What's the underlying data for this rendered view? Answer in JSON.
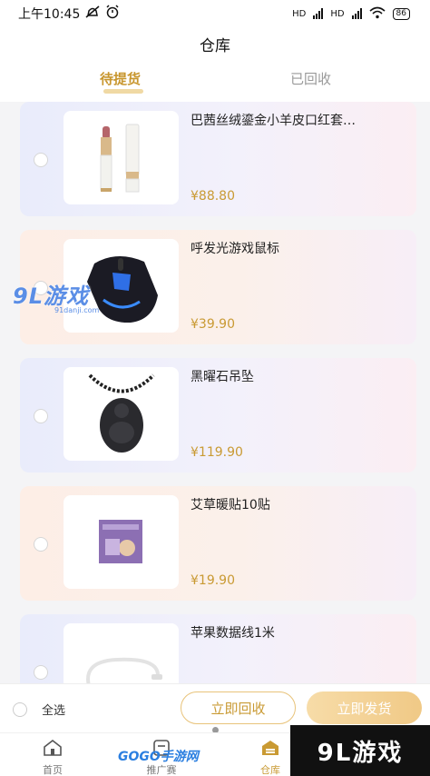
{
  "status_bar": {
    "time": "上午10:45",
    "network1": "HD",
    "network2": "HD",
    "battery": "86"
  },
  "header": {
    "title": "仓库"
  },
  "tabs": [
    {
      "label": "待提货",
      "active": true
    },
    {
      "label": "已回收",
      "active": false
    }
  ],
  "products": [
    {
      "name": "巴茜丝绒鎏金小羊皮口红套…",
      "price": "¥88.80",
      "icon": "lipstick-image"
    },
    {
      "name": "呼发光游戏鼠标",
      "price": "¥39.90",
      "icon": "gaming-mouse-image"
    },
    {
      "name": "黑曜石吊坠",
      "price": "¥119.90",
      "icon": "obsidian-pendant-image"
    },
    {
      "name": "艾草暖贴10贴",
      "price": "¥19.90",
      "icon": "warmer-patch-image"
    },
    {
      "name": "苹果数据线1米",
      "price": "",
      "icon": "usb-cable-image"
    }
  ],
  "action_bar": {
    "select_all": "全选",
    "recycle_button": "立即回收",
    "ship_button": "立即发货"
  },
  "bottom_nav": [
    {
      "label": "首页",
      "icon": "home-icon"
    },
    {
      "label": "推广赛",
      "icon": "promotion-icon"
    },
    {
      "label": "仓库",
      "icon": "warehouse-icon"
    }
  ],
  "watermarks": {
    "left_logo": "9L游戏",
    "left_url": "91danji.com",
    "bottom_logo": "GOGO手游网",
    "right_logo": "9L游戏"
  },
  "colors": {
    "accent": "#c99a33",
    "accent_light": "#f0c986",
    "card_blue": "#e9ecfb",
    "card_peach": "#fdeee6"
  }
}
